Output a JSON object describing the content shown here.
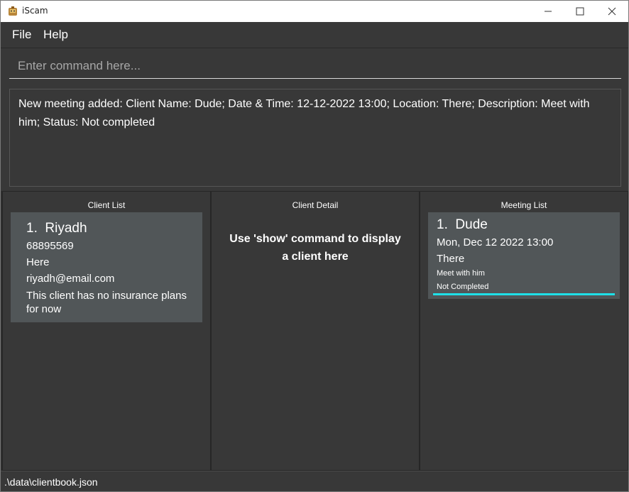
{
  "window": {
    "title": "iScam",
    "minimize_icon": "minimize-icon",
    "maximize_icon": "maximize-icon",
    "close_icon": "close-icon"
  },
  "menu": {
    "items": [
      "File",
      "Help"
    ]
  },
  "command": {
    "value": "",
    "placeholder": "Enter command here..."
  },
  "result": {
    "text": "New meeting added: Client Name: Dude; Date & Time: 12-12-2022 13:00; Location: There; Description: Meet with him; Status: Not completed"
  },
  "client_list": {
    "title": "Client List",
    "clients": [
      {
        "index": "1.",
        "name": "Riyadh",
        "phone": "68895569",
        "address": "Here",
        "email": "riyadh@email.com",
        "plans": "This client has no insurance plans for now"
      }
    ]
  },
  "client_detail": {
    "title": "Client Detail",
    "message": "Use 'show' command to display a client here"
  },
  "meeting_list": {
    "title": "Meeting List",
    "meetings": [
      {
        "index": "1.",
        "name": "Dude",
        "datetime": "Mon, Dec 12 2022 13:00",
        "location": "There",
        "description": "Meet with him",
        "status": "Not Completed"
      }
    ]
  },
  "status_bar": {
    "path": ".\\data\\clientbook.json"
  },
  "colors": {
    "background": "#383838",
    "card": "#515658",
    "selection_accent": "#1ee0e8"
  }
}
